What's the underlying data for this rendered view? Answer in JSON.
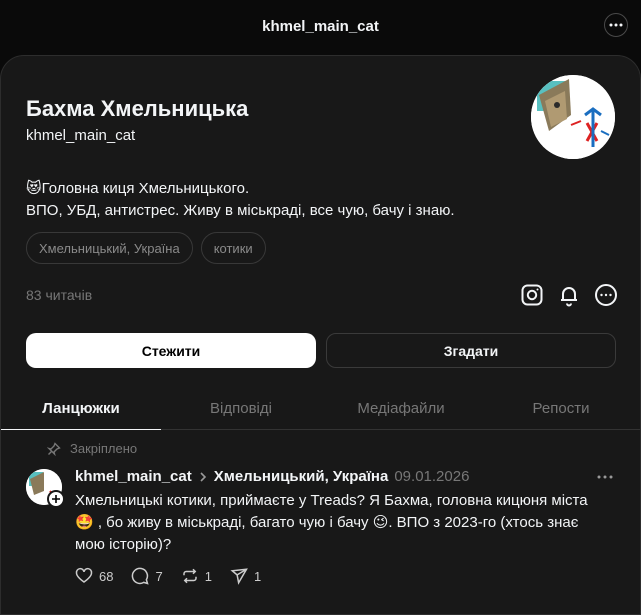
{
  "header": {
    "title": "khmel_main_cat"
  },
  "profile": {
    "display_name": "Бахма Хмельницька",
    "username": "khmel_main_cat",
    "bio_line1": "😻Головна киця Хмельницького.",
    "bio_line2": "ВПО, УБД, антистрес. Живу в міськраді, все чую, бачу і знаю.",
    "chips": [
      "Хмельницький, Україна",
      "котики"
    ],
    "followers": "83 читачів"
  },
  "buttons": {
    "follow": "Стежити",
    "mention": "Згадати"
  },
  "tabs": [
    "Ланцюжки",
    "Відповіді",
    "Медіафайли",
    "Репости"
  ],
  "post": {
    "pinned_label": "Закріплено",
    "username": "khmel_main_cat",
    "location": "Хмельницький, Україна",
    "date": "09.01.2026",
    "text_line1": "Хмельницькі котики, приймаєте у Treads? Я Бахма, головна кицюня міста",
    "text_line2": "🤩 , бо живу в міськраді, багато чую і бачу 😉. ВПО з 2023-го (хтось знає",
    "text_line3": "мою історію)?",
    "likes": "68",
    "comments": "7",
    "reposts": "1",
    "shares": "1"
  },
  "icons": {
    "more": "more-horizontal-icon",
    "instagram": "instagram-icon",
    "bell": "bell-icon",
    "pin": "pin-icon",
    "heart": "heart-icon",
    "comment": "comment-icon",
    "repost": "repost-icon",
    "share": "share-icon"
  }
}
